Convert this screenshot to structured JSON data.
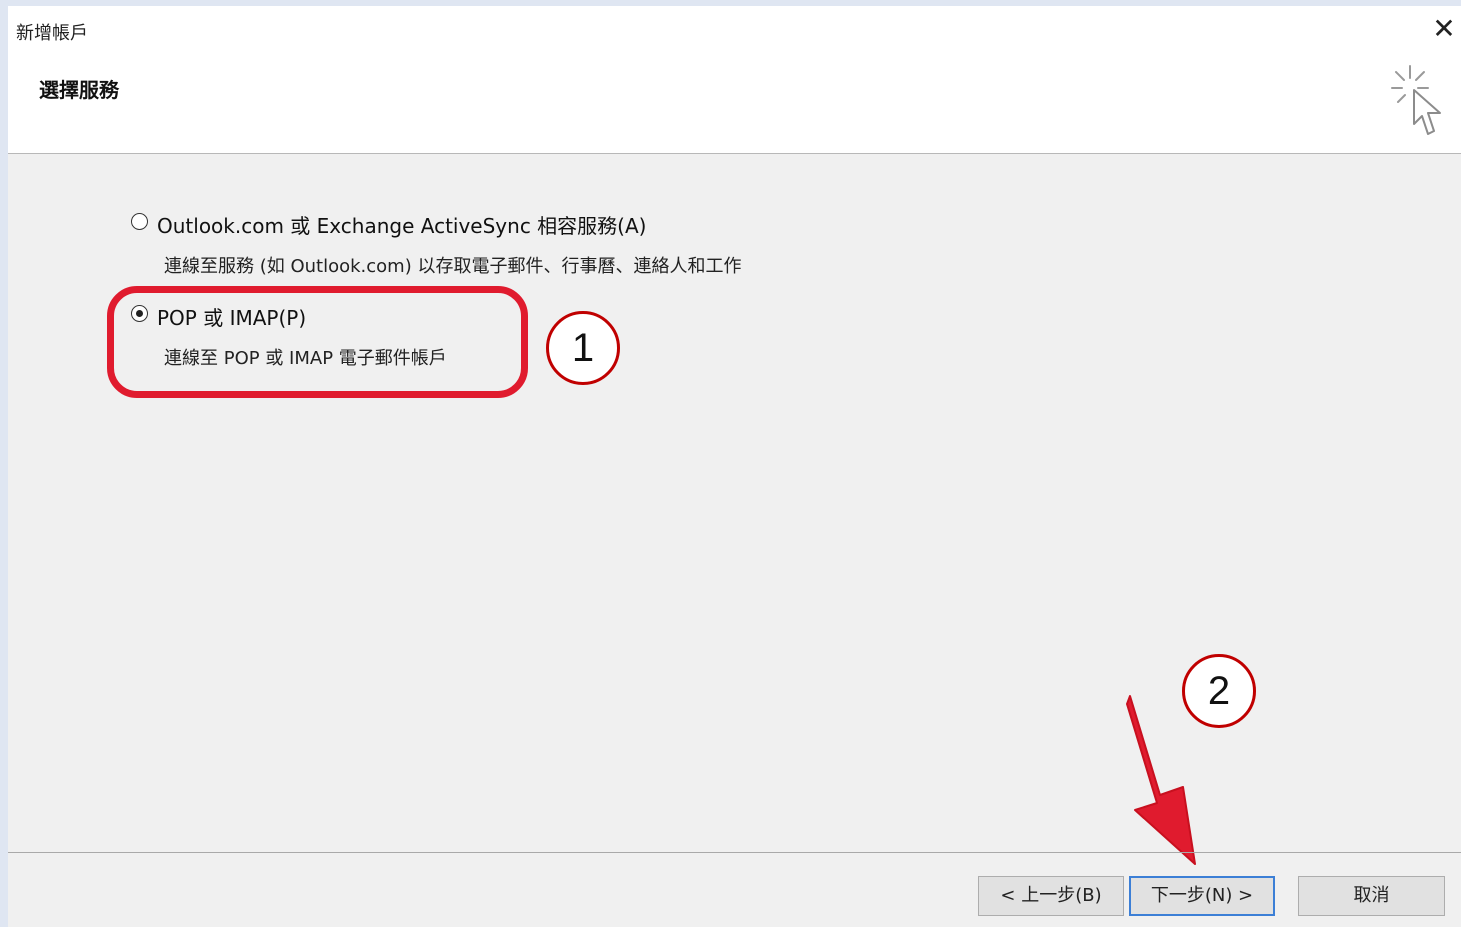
{
  "window": {
    "title": "新增帳戶",
    "close_label": "✕"
  },
  "header": {
    "heading": "選擇服務",
    "icon": "wizard-cursor-icon"
  },
  "options": [
    {
      "label": "Outlook.com 或 Exchange ActiveSync 相容服務(A)",
      "description": "連線至服務 (如 Outlook.com) 以存取電子郵件、行事曆、連絡人和工作",
      "selected": false
    },
    {
      "label": "POP 或 IMAP(P)",
      "description": "連線至 POP 或 IMAP 電子郵件帳戶",
      "selected": true
    }
  ],
  "annotations": {
    "step_1": "1",
    "step_2": "2",
    "highlight_color": "#e01b2e",
    "arrow_color": "#e01b2e"
  },
  "buttons": {
    "back": "< 上一步(B)",
    "next": "下一步(N) >",
    "cancel": "取消"
  }
}
